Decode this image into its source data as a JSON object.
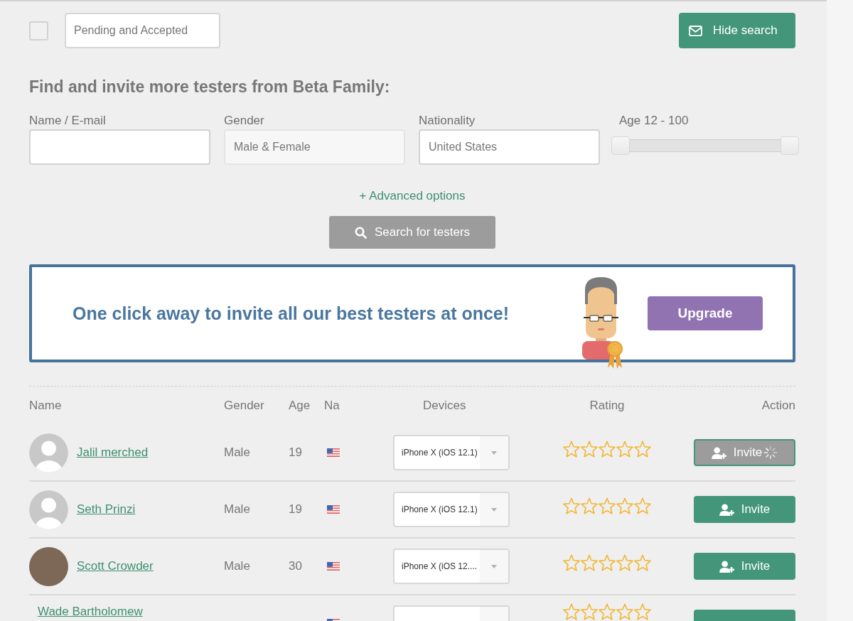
{
  "toolbar": {
    "checkbox": {
      "checked": false
    },
    "status_filter": {
      "value": "Pending and Accepted"
    },
    "hide_search_button": {
      "label": "Hide search"
    }
  },
  "search": {
    "heading": "Find and invite more testers from Beta Family:",
    "fields": [
      {
        "label": "Name / E-mail",
        "disabled": false
      },
      {
        "label": "Gender",
        "value": "Male & Female",
        "disabled": true
      },
      {
        "label": "Nationality",
        "value": "United States",
        "disabled": false
      }
    ],
    "age_slider": {
      "label": "Age 12 - 100",
      "thumbs": [
        {
          "level": 0
        },
        {
          "level": 1
        }
      ]
    },
    "advanced_link": "+ Advanced options",
    "search_button": {
      "label": "Search for testers",
      "disabled": true
    }
  },
  "promo": {
    "text": "One click away to invite all our best testers at once!",
    "button": "Upgrade"
  },
  "table": {
    "columns": [
      "Name",
      "Gender",
      "Age",
      "Na",
      "Devices",
      "Rating",
      "Action"
    ],
    "rows": [
      {
        "kind": "default-avatar",
        "name": "Jalil merched",
        "gender": "Male",
        "age": "19",
        "device": "iPhone X (iOS 12.1)",
        "stars": 0,
        "action": "Invite",
        "loading": true
      },
      {
        "kind": "default-avatar",
        "name": "Seth Prinzi",
        "gender": "Male",
        "age": "19",
        "device": "iPhone X (iOS 12.1)",
        "stars": 0,
        "action": "Invite",
        "loading": false
      },
      {
        "kind": "photo-avatar",
        "name": "Scott Crowder",
        "gender": "Male",
        "age": "30",
        "device": "iPhone X (iOS 12....",
        "stars": 0,
        "action": "Invite",
        "loading": false
      },
      {
        "kind": "no-avatar",
        "name": "Wade Bartholomew",
        "stars": 0,
        "loading": false
      }
    ]
  }
}
